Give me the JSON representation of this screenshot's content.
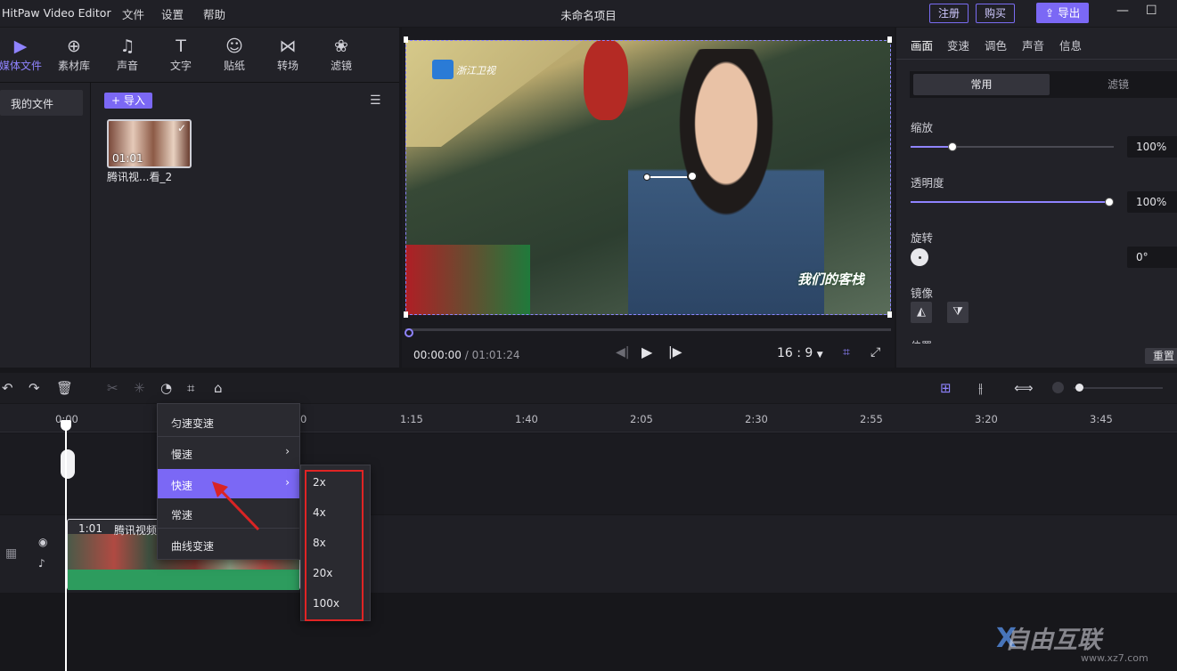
{
  "titlebar": {
    "app": "HitPaw Video Editor",
    "menu": [
      "文件",
      "设置",
      "帮助"
    ],
    "project": "未命名项目",
    "register": "注册",
    "buy": "购买",
    "export": "导出"
  },
  "tools": [
    {
      "label": "媒体文件",
      "icon": "media-icon"
    },
    {
      "label": "素材库",
      "icon": "library-icon"
    },
    {
      "label": "声音",
      "icon": "music-icon"
    },
    {
      "label": "文字",
      "icon": "text-icon"
    },
    {
      "label": "贴纸",
      "icon": "sticker-icon"
    },
    {
      "label": "转场",
      "icon": "transition-icon"
    },
    {
      "label": "滤镜",
      "icon": "filter-icon"
    }
  ],
  "media": {
    "my_files": "我的文件",
    "import": "导入",
    "thumb_time": "01:01",
    "thumb_name": "腾讯视...看_2"
  },
  "preview": {
    "logo_text": "浙江卫视",
    "show_text": "我们的客栈",
    "current": "00:00:00",
    "total": "/ 01:01:24",
    "ratio": "16 : 9",
    "progress": 0
  },
  "right": {
    "tabs": [
      "画面",
      "变速",
      "调色",
      "声音",
      "信息"
    ],
    "seg": [
      "常用",
      "滤镜"
    ],
    "scale": {
      "label": "缩放",
      "value": "100%"
    },
    "opacity": {
      "label": "透明度",
      "value": "100%"
    },
    "rotate": {
      "label": "旋转",
      "value": "0°"
    },
    "mirror": {
      "label": "镜像"
    },
    "position": {
      "label": "位置"
    },
    "reset": "重置"
  },
  "ruler": [
    "0:00",
    "0",
    "1:15",
    "1:40",
    "2:05",
    "2:30",
    "2:55",
    "3:20",
    "3:45"
  ],
  "clip": {
    "time": "1:01",
    "name": "腾讯视频"
  },
  "speed_menu": {
    "items": [
      "匀速变速",
      "慢速",
      "快速",
      "常速",
      "曲线变速"
    ],
    "sub": [
      "2x",
      "4x",
      "8x",
      "20x",
      "100x"
    ]
  },
  "watermark": {
    "brand": "自由互联",
    "url": "www.xz7.com"
  },
  "colors": {
    "accent": "#7b68f5",
    "highlight_box": "#e02424"
  }
}
